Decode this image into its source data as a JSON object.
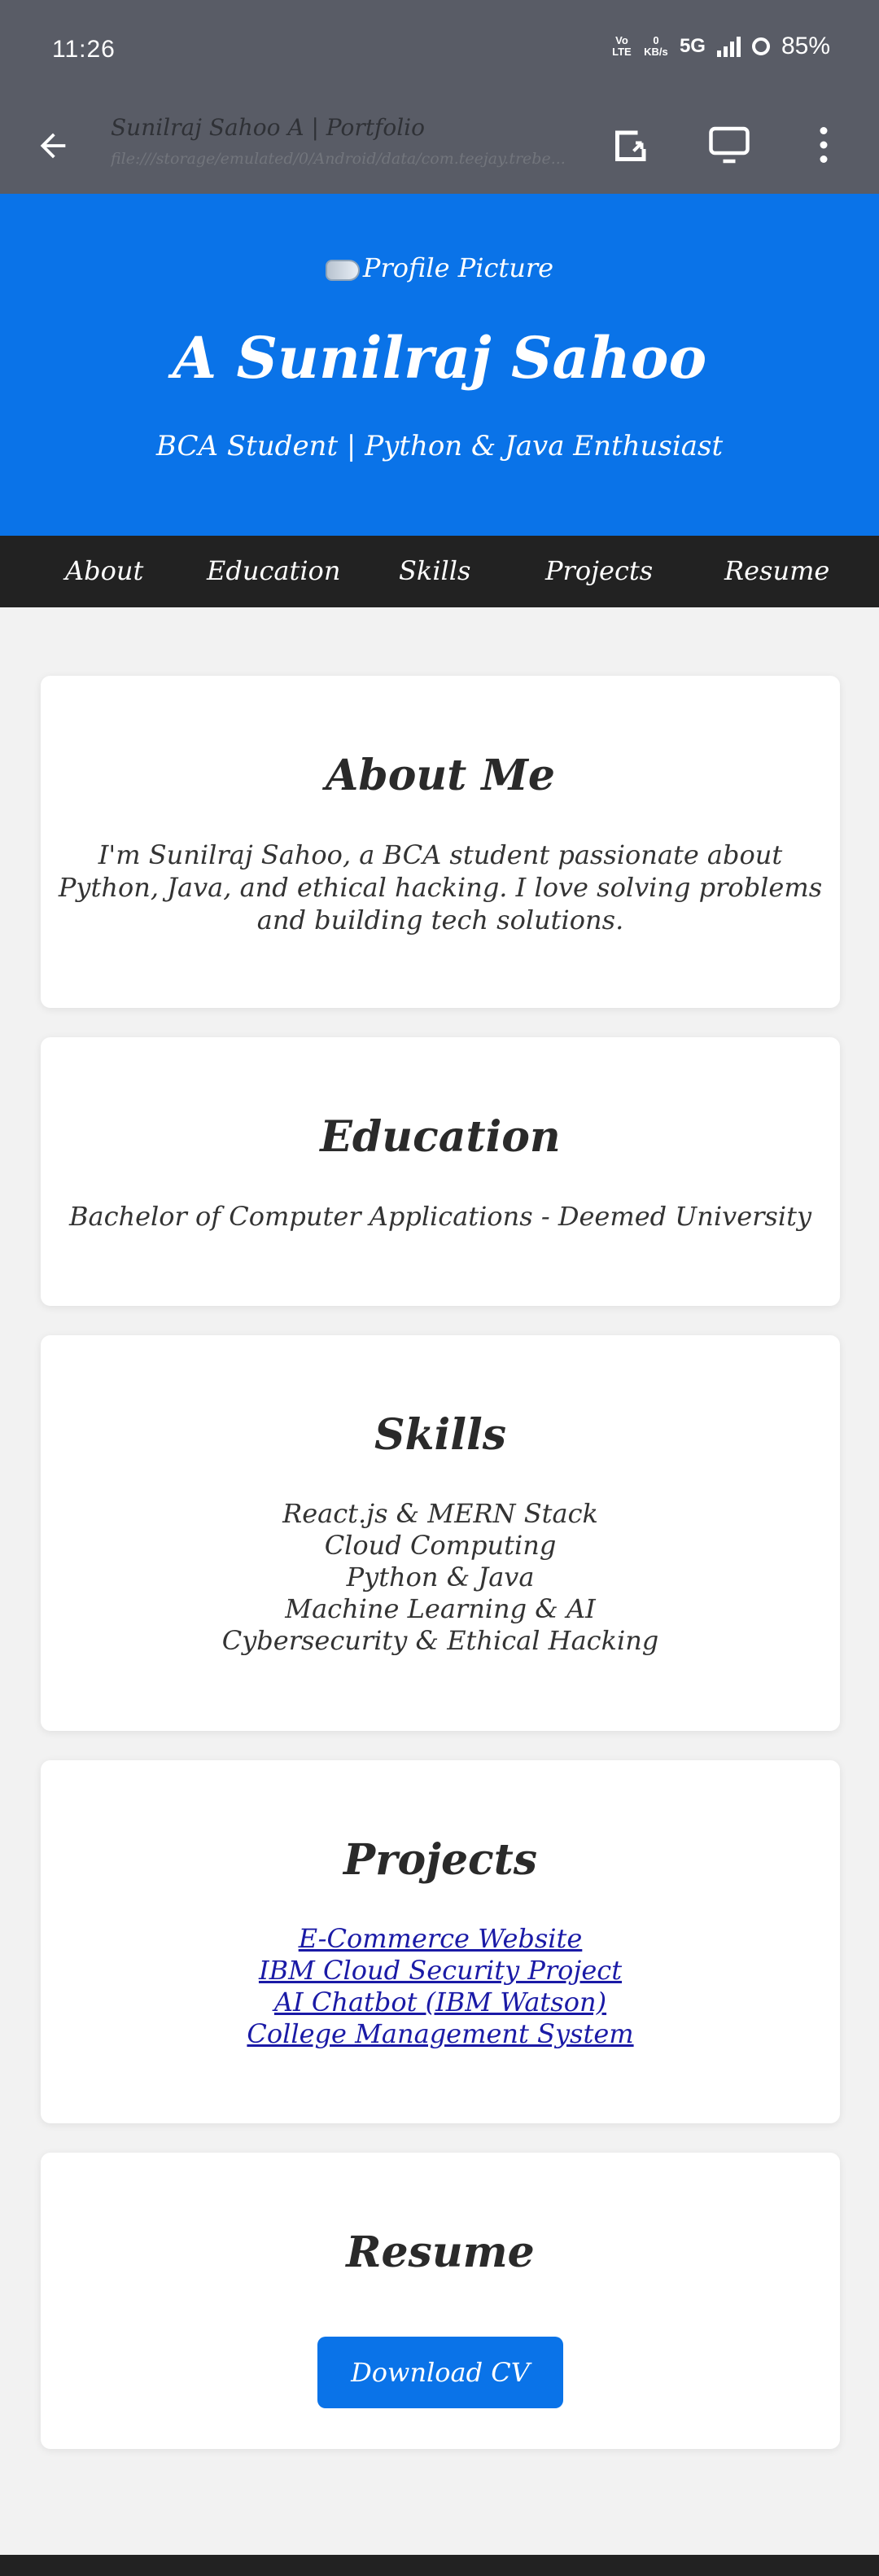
{
  "status": {
    "time": "11:26",
    "volte": "Vo LTE",
    "data_rate": "0 KB/s",
    "network": "5G",
    "battery": "85%"
  },
  "toolbar": {
    "title": "Sunilraj Sahoo A | Portfolio",
    "url": "file:///storage/emulated/0/Android/data/com.teejay.trebe..."
  },
  "hero": {
    "profile_picture_alt": "Profile Picture",
    "name": "A Sunilraj Sahoo",
    "tagline": "BCA Student | Python & Java Enthusiast"
  },
  "nav": {
    "items": [
      "About",
      "Education",
      "Skills",
      "Projects",
      "Resume"
    ]
  },
  "about": {
    "heading": "About Me",
    "lines": [
      "I'm Sunilraj Sahoo, a BCA student passionate about",
      "Python, Java, and ethical hacking. I love solving problems",
      "and building tech solutions."
    ]
  },
  "education": {
    "heading": "Education",
    "text": "Bachelor of Computer Applications - Deemed University"
  },
  "skills": {
    "heading": "Skills",
    "items": [
      "React.js & MERN Stack",
      "Cloud Computing",
      "Python & Java",
      "Machine Learning & AI",
      "Cybersecurity & Ethical Hacking"
    ]
  },
  "projects": {
    "heading": "Projects",
    "items": [
      "E-Commerce Website",
      "IBM Cloud Security Project",
      "AI Chatbot (IBM Watson)",
      "College Management System"
    ]
  },
  "resume": {
    "heading": "Resume",
    "button": "Download CV"
  }
}
